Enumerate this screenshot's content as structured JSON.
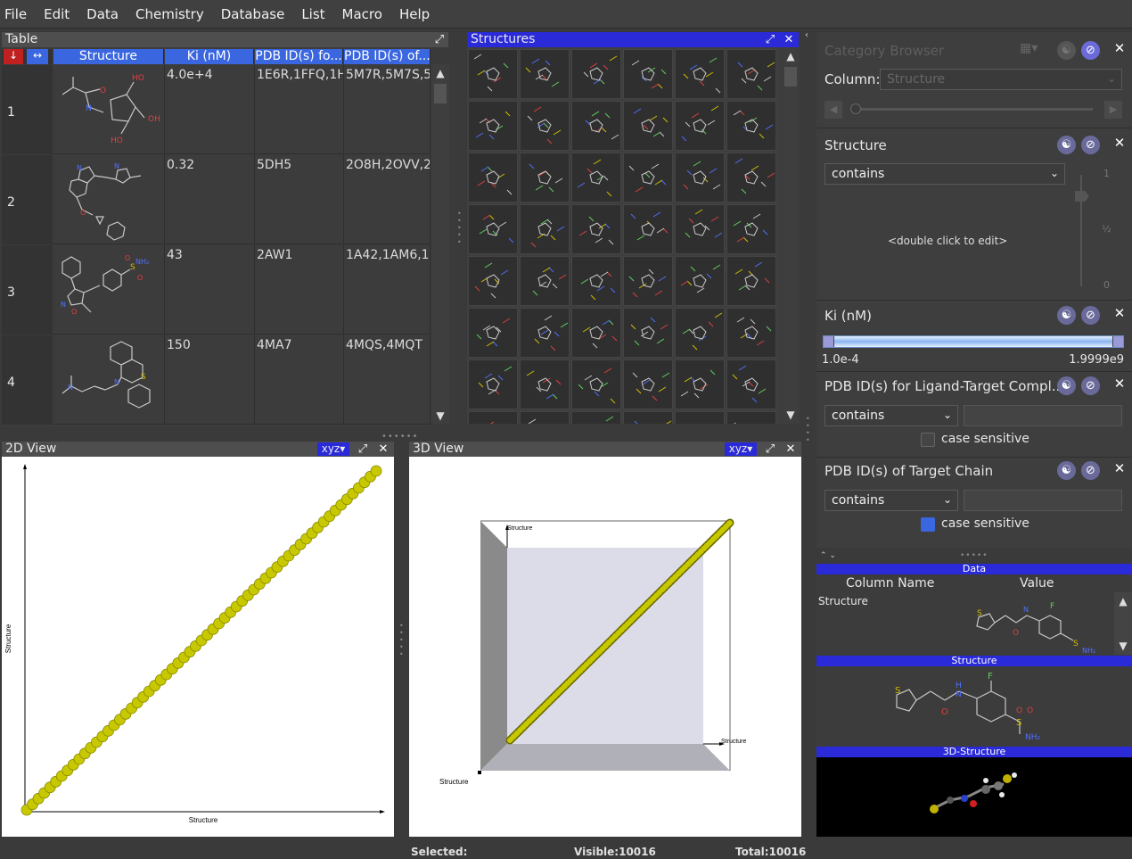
{
  "menu": [
    "File",
    "Edit",
    "Data",
    "Chemistry",
    "Database",
    "List",
    "Macro",
    "Help"
  ],
  "table": {
    "title": "Table",
    "columns": [
      "Structure",
      "Ki (nM)",
      "PDB ID(s) fo...",
      "PDB ID(s) of..."
    ],
    "rows": [
      {
        "num": "1",
        "ki": "4.0e+4",
        "pdb1": "1E6R,1FFQ,1H",
        "pdb2": "5M7R,5M7S,5"
      },
      {
        "num": "2",
        "ki": "0.32",
        "pdb1": "5DH5",
        "pdb2": "2O8H,2OVV,2"
      },
      {
        "num": "3",
        "ki": "43",
        "pdb1": "2AW1",
        "pdb2": "1A42,1AM6,1"
      },
      {
        "num": "4",
        "ki": "150",
        "pdb1": "4MA7",
        "pdb2": "4MQS,4MQT"
      }
    ]
  },
  "structures": {
    "title": "Structures"
  },
  "view2d": {
    "title": "2D View",
    "axes_btn": "xyz",
    "xlabel": "Structure",
    "ylabel": "Structure"
  },
  "view3d": {
    "title": "3D View",
    "axes_btn": "xyz",
    "xlabel": "Structure",
    "ylabel": "Structure",
    "zlabel": "Structure"
  },
  "filters": {
    "category_browser": "Category Browser",
    "column_label": "Column:",
    "column_value": "Structure",
    "structure": {
      "title": "Structure",
      "mode": "contains",
      "hint": "<double click to edit>",
      "slider_top": "1",
      "slider_mid": "½",
      "slider_bot": "0"
    },
    "ki": {
      "title": "Ki (nM)",
      "min": "1.0e-4",
      "max": "1.9999e9"
    },
    "pdb_ligand": {
      "title": "PDB ID(s) for Ligand-Target Compl...",
      "mode": "contains",
      "case": "case sensitive"
    },
    "pdb_chain": {
      "title": "PDB ID(s) of Target Chain",
      "mode": "contains",
      "case": "case sensitive"
    }
  },
  "details": {
    "data_header": "Data",
    "col_name": "Column Name",
    "col_value": "Value",
    "row_name": "Structure",
    "structure_header": "Structure",
    "structure3d_header": "3D-Structure"
  },
  "status": {
    "selected_label": "Selected:",
    "visible_label": "Visible:",
    "visible": "10016",
    "total_label": "Total:",
    "total": "10016"
  },
  "colors": {
    "accent": "#2a2ad8",
    "scatter": "#c8c800"
  }
}
